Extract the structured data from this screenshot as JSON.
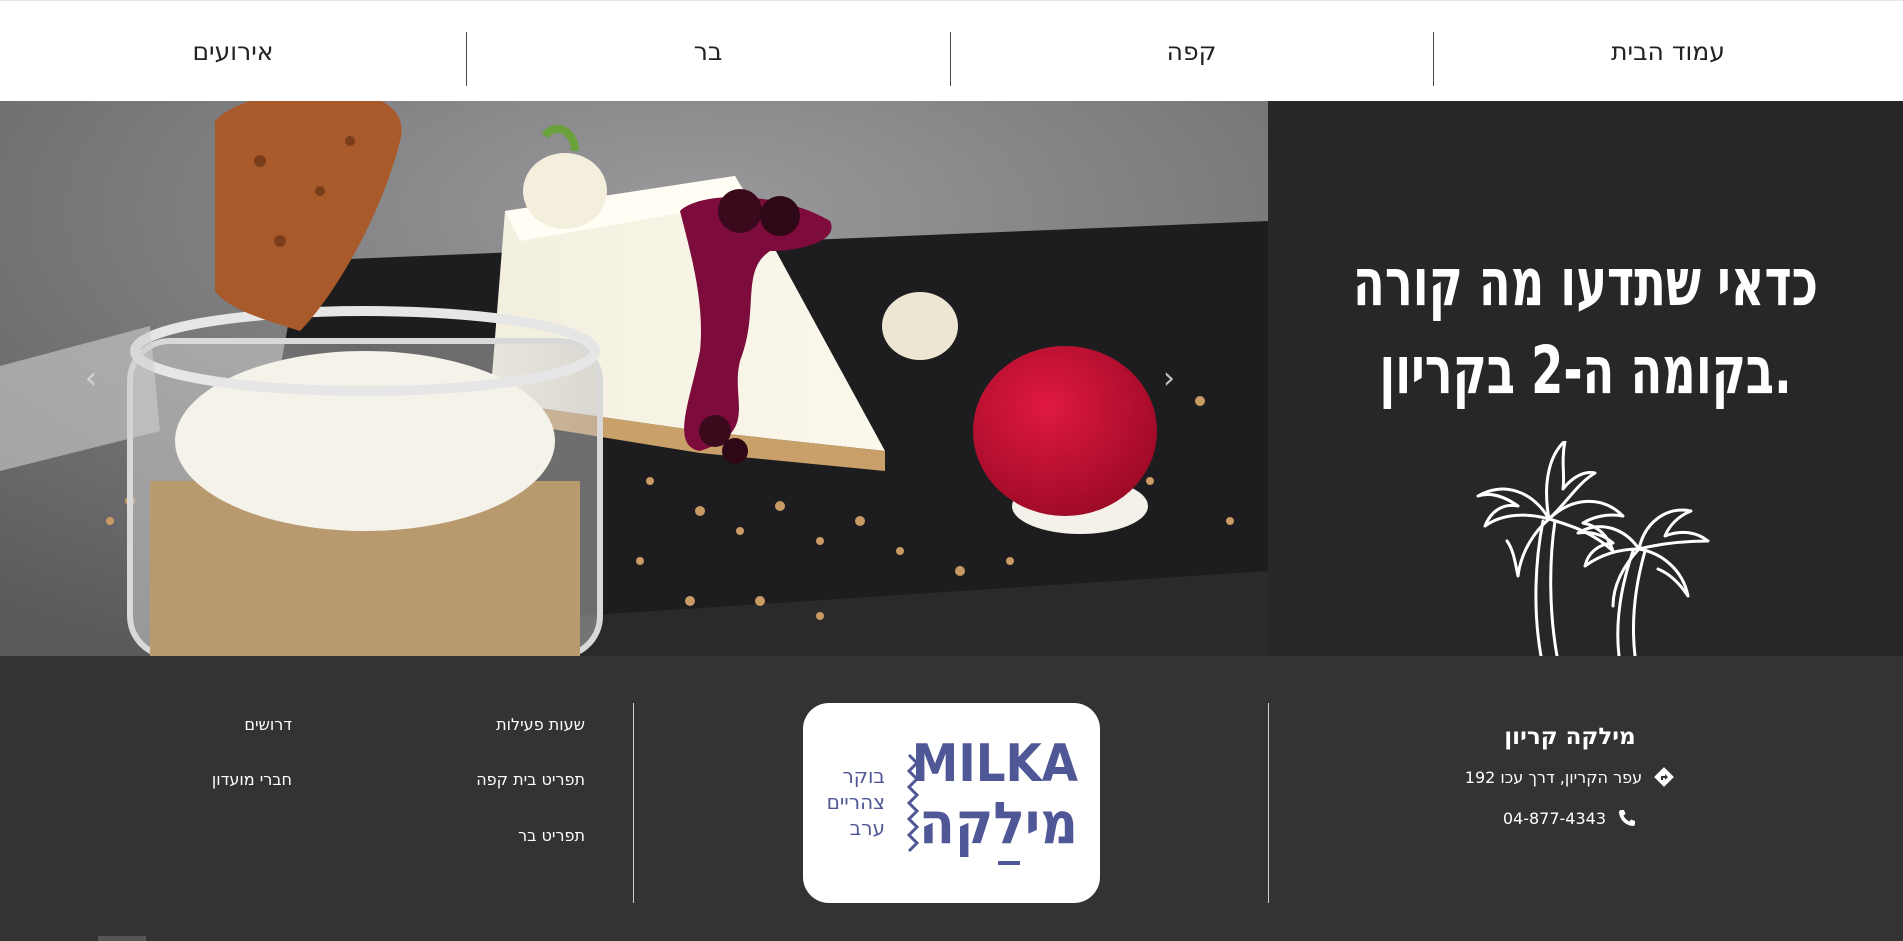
{
  "nav": {
    "items": [
      {
        "label": "עמוד הבית"
      },
      {
        "label": "קפה"
      },
      {
        "label": "בר"
      },
      {
        "label": "אירועים"
      }
    ]
  },
  "hero": {
    "headline_line1": "כדאי שתדעו מה קורה",
    "headline_line2": "בקומה ה-2 בקריון.",
    "prev_icon": "chevron-left-icon",
    "next_icon": "chevron-right-icon",
    "side_bg_color": "#272727"
  },
  "footer": {
    "bg_color": "#333333",
    "brand_name": "מילקה קריון",
    "address": "עפר הקריון, דרך עכו 192",
    "address_icon": "directions-icon",
    "phone": "04-877-4343",
    "phone_icon": "phone-icon",
    "logo": {
      "latin": "MILKA",
      "hebrew": "מילקה",
      "tagline": [
        "בוקר",
        "צהריים",
        "ערב"
      ],
      "color": "#4f5796"
    },
    "links_col1": [
      {
        "label": "שעות פעילות"
      },
      {
        "label": "תפריט בית קפה"
      },
      {
        "label": "תפריט בר"
      }
    ],
    "links_col2": [
      {
        "label": "דרושים"
      },
      {
        "label": "חברי מועדון"
      }
    ]
  }
}
